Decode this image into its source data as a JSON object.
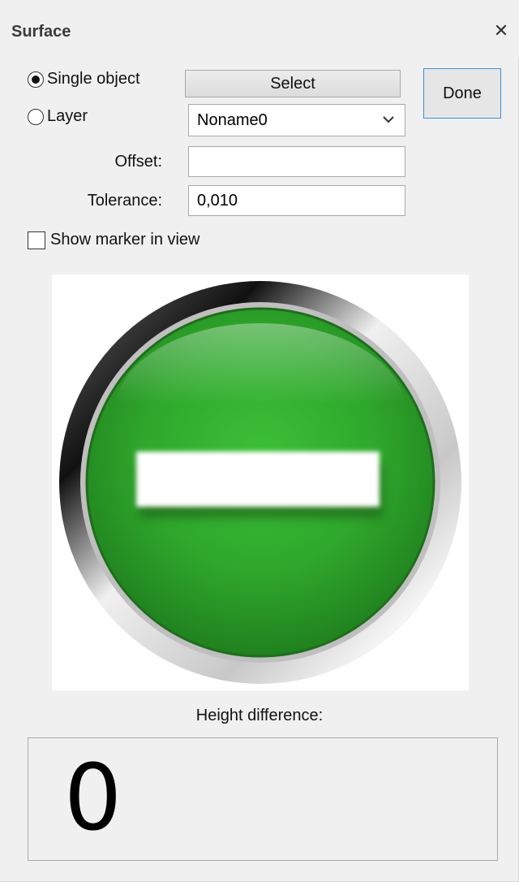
{
  "window": {
    "title": "Surface",
    "close_icon": "close-icon"
  },
  "selection": {
    "single_object_label": "Single object",
    "single_object_checked": true,
    "layer_label": "Layer",
    "layer_checked": false,
    "select_button_label": "Select",
    "layer_dropdown_value": "Noname0"
  },
  "done_button_label": "Done",
  "fields": {
    "offset_label": "Offset:",
    "offset_value": "",
    "tolerance_label": "Tolerance:",
    "tolerance_value": "0,010"
  },
  "show_marker": {
    "label": "Show marker in view",
    "checked": false
  },
  "status_image": {
    "icon": "no-entry-icon",
    "accent_color": "#34a830"
  },
  "height_difference": {
    "label": "Height difference:",
    "value": "0"
  }
}
